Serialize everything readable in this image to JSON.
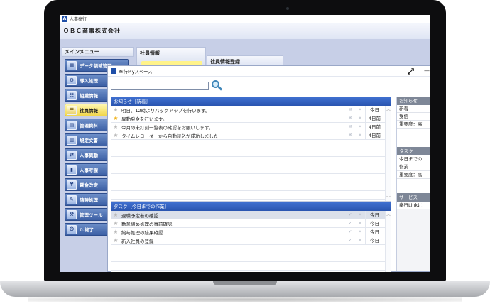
{
  "window": {
    "app_title": "人事奉行",
    "app_icon": "A"
  },
  "company": {
    "name": "ＯＢＣ商事株式会社"
  },
  "menu": {
    "title": "メインメニュー",
    "items": [
      {
        "label": "データ領域管理",
        "icon": "database-icon",
        "glyph": "▦",
        "active": false
      },
      {
        "label": "導入処理",
        "icon": "setup-icon",
        "glyph": "⚙",
        "active": false
      },
      {
        "label": "組織情報",
        "icon": "org-icon",
        "glyph": "☷",
        "active": false
      },
      {
        "label": "社員情報",
        "icon": "employee-icon",
        "glyph": "☰",
        "active": true
      },
      {
        "label": "管理資料",
        "icon": "report-icon",
        "glyph": "▤",
        "active": false
      },
      {
        "label": "規定文書",
        "icon": "document-icon",
        "glyph": "▥",
        "active": false
      },
      {
        "label": "人事異動",
        "icon": "transfer-icon",
        "glyph": "⇄",
        "active": false
      },
      {
        "label": "人事考課",
        "icon": "evaluation-icon",
        "glyph": "▮",
        "active": false
      },
      {
        "label": "賃金改定",
        "icon": "wage-icon",
        "glyph": "¥",
        "active": false
      },
      {
        "label": "随時処理",
        "icon": "process-icon",
        "glyph": "✎",
        "active": false
      },
      {
        "label": "管理ツール",
        "icon": "tools-icon",
        "glyph": "⚒",
        "active": false
      },
      {
        "label": "0.終了",
        "icon": "exit-icon",
        "glyph": "⏻",
        "active": false
      }
    ]
  },
  "tabs": {
    "tab1": "社員情報",
    "tab2": "社員情報登録"
  },
  "myspace": {
    "title": "奉行Myスペース",
    "search_placeholder": "",
    "news": {
      "header": "お知らせ［新着］",
      "rows": [
        {
          "text": "明日、12時よりバックアップを行います。",
          "date": "今日",
          "starred": false
        },
        {
          "text": "異動発令を行います。",
          "date": "4日前",
          "starred": true
        },
        {
          "text": "今月の未打刻一覧表の確認をお願いします。",
          "date": "4日前",
          "starred": false
        },
        {
          "text": "タイムレコーダーから自動読込が成功しました",
          "date": "4日前",
          "starred": false
        }
      ]
    },
    "tasks": {
      "header": "タスク［今日までの作業］",
      "rows": [
        {
          "text": "退職予定者の確認",
          "date": "今日",
          "selected": true
        },
        {
          "text": "勤怠締め処理の事前確認",
          "date": "今日",
          "selected": false
        },
        {
          "text": "給与処理の結果確認",
          "date": "今日",
          "selected": false
        },
        {
          "text": "新入社員の登録",
          "date": "今日",
          "selected": false
        }
      ]
    },
    "side": {
      "news_header": "お知らせ",
      "news_lines": [
        "新着",
        "受信",
        "重要度：高"
      ],
      "task_header": "タスク",
      "task_lines": [
        "今日までの",
        "作業",
        "重要度：高"
      ],
      "service_header": "サービス",
      "service_lines": [
        "奉行Linkに"
      ]
    }
  }
}
